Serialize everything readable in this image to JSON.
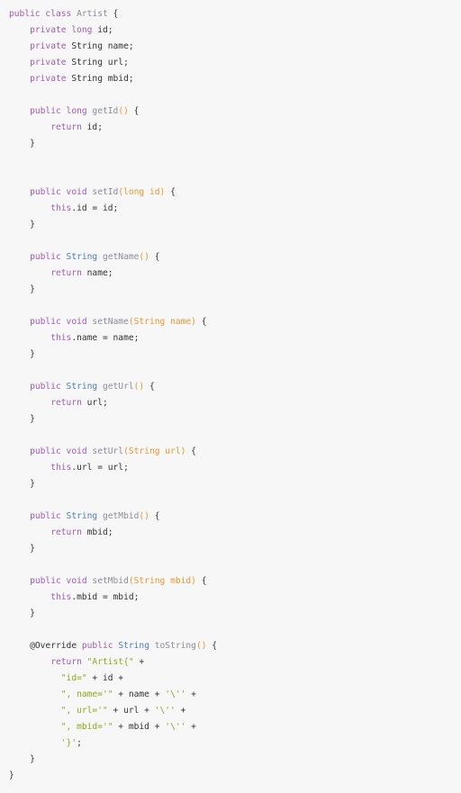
{
  "colors": {
    "background": "#f7f7f7",
    "keyword": "#a05cb0",
    "type": "#4a7cc2",
    "function": "#8c8c9c",
    "params": "#e8972c",
    "string": "#8caa1c",
    "text": "#333333"
  },
  "code_lines": [
    [
      [
        "kw",
        "public class "
      ],
      [
        "fn",
        "Artist"
      ],
      [
        "id",
        " {"
      ]
    ],
    [
      [
        "id",
        "    "
      ],
      [
        "kw",
        "private long "
      ],
      [
        "id",
        "id;"
      ]
    ],
    [
      [
        "id",
        "    "
      ],
      [
        "kw",
        "private "
      ],
      [
        "id",
        "String name;"
      ]
    ],
    [
      [
        "id",
        "    "
      ],
      [
        "kw",
        "private "
      ],
      [
        "id",
        "String url;"
      ]
    ],
    [
      [
        "id",
        "    "
      ],
      [
        "kw",
        "private "
      ],
      [
        "id",
        "String mbid;"
      ]
    ],
    [],
    [
      [
        "id",
        "    "
      ],
      [
        "kw",
        "public long "
      ],
      [
        "fn",
        "getId"
      ],
      [
        "pa",
        "()"
      ],
      [
        "id",
        " {"
      ]
    ],
    [
      [
        "id",
        "        "
      ],
      [
        "kw",
        "return "
      ],
      [
        "id",
        "id;"
      ]
    ],
    [
      [
        "id",
        "    }"
      ]
    ],
    [],
    [],
    [
      [
        "id",
        "    "
      ],
      [
        "kw",
        "public void "
      ],
      [
        "fn",
        "setId"
      ],
      [
        "pa",
        "(long id)"
      ],
      [
        "id",
        " {"
      ]
    ],
    [
      [
        "id",
        "        "
      ],
      [
        "kw",
        "this"
      ],
      [
        "id",
        ".id = id;"
      ]
    ],
    [
      [
        "id",
        "    }"
      ]
    ],
    [],
    [
      [
        "id",
        "    "
      ],
      [
        "kw",
        "public "
      ],
      [
        "ty",
        "String "
      ],
      [
        "fn",
        "getName"
      ],
      [
        "pa",
        "()"
      ],
      [
        "id",
        " {"
      ]
    ],
    [
      [
        "id",
        "        "
      ],
      [
        "kw",
        "return "
      ],
      [
        "id",
        "name;"
      ]
    ],
    [
      [
        "id",
        "    }"
      ]
    ],
    [],
    [
      [
        "id",
        "    "
      ],
      [
        "kw",
        "public void "
      ],
      [
        "fn",
        "setName"
      ],
      [
        "pa",
        "(String name)"
      ],
      [
        "id",
        " {"
      ]
    ],
    [
      [
        "id",
        "        "
      ],
      [
        "kw",
        "this"
      ],
      [
        "id",
        ".name = name;"
      ]
    ],
    [
      [
        "id",
        "    }"
      ]
    ],
    [],
    [
      [
        "id",
        "    "
      ],
      [
        "kw",
        "public "
      ],
      [
        "ty",
        "String "
      ],
      [
        "fn",
        "getUrl"
      ],
      [
        "pa",
        "()"
      ],
      [
        "id",
        " {"
      ]
    ],
    [
      [
        "id",
        "        "
      ],
      [
        "kw",
        "return "
      ],
      [
        "id",
        "url;"
      ]
    ],
    [
      [
        "id",
        "    }"
      ]
    ],
    [],
    [
      [
        "id",
        "    "
      ],
      [
        "kw",
        "public void "
      ],
      [
        "fn",
        "setUrl"
      ],
      [
        "pa",
        "(String url)"
      ],
      [
        "id",
        " {"
      ]
    ],
    [
      [
        "id",
        "        "
      ],
      [
        "kw",
        "this"
      ],
      [
        "id",
        ".url = url;"
      ]
    ],
    [
      [
        "id",
        "    }"
      ]
    ],
    [],
    [
      [
        "id",
        "    "
      ],
      [
        "kw",
        "public "
      ],
      [
        "ty",
        "String "
      ],
      [
        "fn",
        "getMbid"
      ],
      [
        "pa",
        "()"
      ],
      [
        "id",
        " {"
      ]
    ],
    [
      [
        "id",
        "        "
      ],
      [
        "kw",
        "return "
      ],
      [
        "id",
        "mbid;"
      ]
    ],
    [
      [
        "id",
        "    }"
      ]
    ],
    [],
    [
      [
        "id",
        "    "
      ],
      [
        "kw",
        "public void "
      ],
      [
        "fn",
        "setMbid"
      ],
      [
        "pa",
        "(String mbid)"
      ],
      [
        "id",
        " {"
      ]
    ],
    [
      [
        "id",
        "        "
      ],
      [
        "kw",
        "this"
      ],
      [
        "id",
        ".mbid = mbid;"
      ]
    ],
    [
      [
        "id",
        "    }"
      ]
    ],
    [],
    [
      [
        "id",
        "    "
      ],
      [
        "an",
        "@Override "
      ],
      [
        "kw",
        "public "
      ],
      [
        "ty",
        "String "
      ],
      [
        "fn",
        "toString"
      ],
      [
        "pa",
        "()"
      ],
      [
        "id",
        " {"
      ]
    ],
    [
      [
        "id",
        "        "
      ],
      [
        "kw",
        "return "
      ],
      [
        "st",
        "\"Artist{\""
      ],
      [
        "id",
        " +"
      ]
    ],
    [
      [
        "id",
        "          "
      ],
      [
        "st",
        "\"id=\""
      ],
      [
        "id",
        " + id +"
      ]
    ],
    [
      [
        "id",
        "          "
      ],
      [
        "st",
        "\", name='\""
      ],
      [
        "id",
        " + name + "
      ],
      [
        "st",
        "'\\''"
      ],
      [
        "id",
        " +"
      ]
    ],
    [
      [
        "id",
        "          "
      ],
      [
        "st",
        "\", url='\""
      ],
      [
        "id",
        " + url + "
      ],
      [
        "st",
        "'\\''"
      ],
      [
        "id",
        " +"
      ]
    ],
    [
      [
        "id",
        "          "
      ],
      [
        "st",
        "\", mbid='\""
      ],
      [
        "id",
        " + mbid + "
      ],
      [
        "st",
        "'\\''"
      ],
      [
        "id",
        " +"
      ]
    ],
    [
      [
        "id",
        "          "
      ],
      [
        "st",
        "'}'"
      ],
      [
        "id",
        ";"
      ]
    ],
    [
      [
        "id",
        "    }"
      ]
    ],
    [
      [
        "id",
        "}"
      ]
    ]
  ]
}
